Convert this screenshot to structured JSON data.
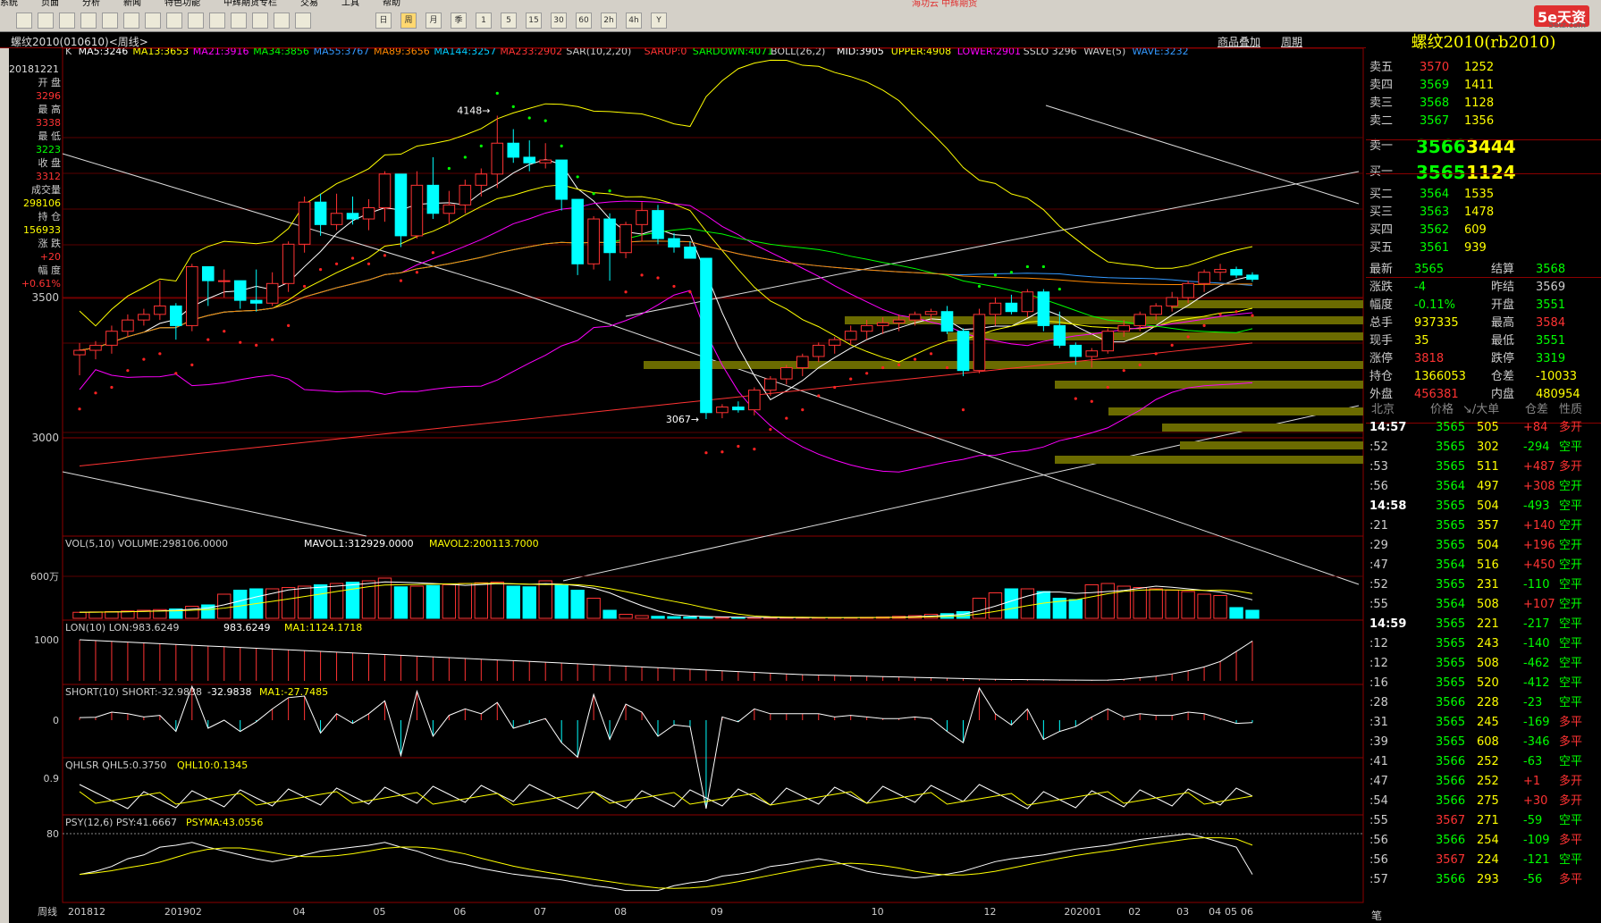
{
  "menu": [
    "系统",
    "页面",
    "分析",
    "新闻",
    "特色功能",
    "中辉期货专栏",
    "交易",
    "工具",
    "帮助"
  ],
  "broker": "海功云 中辉期货",
  "logo": {
    "text": "5e天资",
    "sub": "5etz.com"
  },
  "toolbar_period_labels": [
    "日",
    "周",
    "月",
    "季",
    "1",
    "5",
    "15",
    "30",
    "60",
    "2h",
    "4h",
    "Y"
  ],
  "window": {
    "title": "螺纹2010(010610)<周线>",
    "overlay": "商品叠加",
    "period": "周期"
  },
  "indicators": {
    "ma_line": "K  MA5:3246  MA13:3653  MA21:3916  MA34:3856  MA55:3767  MA89:3656  MA144:3257  MA233:2902  SAR(10,2,20)  SARUP:0  SARDOWN:4071  BOLL(26,2)  MID:3905  UPPER:4908  LOWER:2901  SSLO 3296  WAVE(5)  WAVE:3232"
  },
  "ind_parts": [
    {
      "t": "K",
      "c": "#cccccc"
    },
    {
      "t": "MA5:3246",
      "c": "#ffffff"
    },
    {
      "t": "MA13:3653",
      "c": "#ffff00"
    },
    {
      "t": "MA21:3916",
      "c": "#ff00ff"
    },
    {
      "t": "MA34:3856",
      "c": "#00ff00"
    },
    {
      "t": "MA55:3767",
      "c": "#3399ff"
    },
    {
      "t": "MA89:3656",
      "c": "#ff8800"
    },
    {
      "t": "MA144:3257",
      "c": "#00ccff"
    },
    {
      "t": "MA233:2902",
      "c": "#ff3333"
    },
    {
      "t": "SAR(10,2,20)",
      "c": "#cccccc"
    },
    {
      "t": "SARUP:0",
      "c": "#ff3333"
    },
    {
      "t": "SARDOWN:4071",
      "c": "#00ff00"
    },
    {
      "t": "BOLL(26,2)",
      "c": "#cccccc"
    },
    {
      "t": "MID:3905",
      "c": "#ffffff"
    },
    {
      "t": "UPPER:4908",
      "c": "#ffff00"
    },
    {
      "t": "LOWER:2901",
      "c": "#ff00ff"
    },
    {
      "t": "SSLO 3296",
      "c": "#cccccc"
    },
    {
      "t": "WAVE(5)",
      "c": "#cccccc"
    },
    {
      "t": "WAVE:3232",
      "c": "#3399ff"
    }
  ],
  "info": {
    "date": "20181221",
    "open_label": "开  盘",
    "open": "3296",
    "high_label": "最  高",
    "high": "3338",
    "low_label": "最  低",
    "low": "3223",
    "close_label": "收  盘",
    "close": "3312",
    "vol_label": "成交量",
    "vol": "298106",
    "oi_label": "持  仓",
    "oi": "156933",
    "chg_label": "涨  跌",
    "chg": "+20",
    "pct_label": "幅  度",
    "pct": "+0.61%"
  },
  "annotations": {
    "high": "4148",
    "low": "3067"
  },
  "panels": {
    "vol": {
      "label": "VOL(5,10)",
      "value": "VOLUME:298106.0000",
      "m1": "MAVOL1:312929.0000",
      "m2": "MAVOL2:200113.7000",
      "tick": "600万"
    },
    "lon": {
      "label": "LON(10)",
      "value": "LON:983.6249",
      "v2": "983.6249",
      "ma": "MA1:1124.1718",
      "tick": "1000"
    },
    "short": {
      "label": "SHORT(10)",
      "value": "SHORT:-32.9838",
      "v2": "-32.9838",
      "ma": "MA1:-27.7485",
      "tick": "0"
    },
    "qhl": {
      "label": "QHLSR",
      "value": "QHL5:0.3750",
      "ma": "QHL10:0.1345",
      "tick": "0.9"
    },
    "psy": {
      "label": "PSY(12,6)",
      "value": "PSY:41.6667",
      "ma": "PSYMA:43.0556",
      "tick": "80"
    }
  },
  "xaxis": {
    "period_label": "周线",
    "ticks": [
      "201812",
      "201902",
      "04",
      "05",
      "06",
      "07",
      "08",
      "09",
      "10",
      "12",
      "202001",
      "02",
      "03",
      "04",
      "05",
      "06"
    ]
  },
  "chart_data": {
    "type": "candlestick",
    "title": "螺纹2010(010610)<周线>",
    "yticks": [
      3500,
      3000
    ],
    "ohlc": [
      [
        3296,
        3338,
        3223,
        3312
      ],
      [
        3312,
        3345,
        3280,
        3330
      ],
      [
        3330,
        3400,
        3300,
        3380
      ],
      [
        3380,
        3440,
        3360,
        3420
      ],
      [
        3420,
        3460,
        3400,
        3440
      ],
      [
        3440,
        3560,
        3420,
        3470
      ],
      [
        3470,
        3480,
        3350,
        3400
      ],
      [
        3400,
        3620,
        3380,
        3610
      ],
      [
        3610,
        3560,
        3470,
        3560
      ],
      [
        3560,
        3600,
        3500,
        3560
      ],
      [
        3560,
        3560,
        3460,
        3490
      ],
      [
        3490,
        3600,
        3450,
        3480
      ],
      [
        3480,
        3590,
        3470,
        3550
      ],
      [
        3550,
        3700,
        3520,
        3690
      ],
      [
        3690,
        3860,
        3660,
        3840
      ],
      [
        3840,
        3870,
        3720,
        3760
      ],
      [
        3760,
        3870,
        3740,
        3800
      ],
      [
        3800,
        3860,
        3760,
        3780
      ],
      [
        3780,
        3850,
        3740,
        3820
      ],
      [
        3820,
        3950,
        3770,
        3940
      ],
      [
        3940,
        3940,
        3680,
        3720
      ],
      [
        3720,
        3950,
        3710,
        3900
      ],
      [
        3900,
        4000,
        3780,
        3800
      ],
      [
        3800,
        3880,
        3760,
        3830
      ],
      [
        3830,
        3920,
        3800,
        3900
      ],
      [
        3900,
        3960,
        3860,
        3940
      ],
      [
        3940,
        4148,
        3890,
        4050
      ],
      [
        4050,
        4100,
        3980,
        4000
      ],
      [
        4000,
        4060,
        3950,
        3980
      ],
      [
        3980,
        4050,
        3960,
        3990
      ],
      [
        3990,
        3960,
        3810,
        3850
      ],
      [
        3850,
        3850,
        3580,
        3620
      ],
      [
        3620,
        3790,
        3600,
        3780
      ],
      [
        3780,
        3800,
        3560,
        3660
      ],
      [
        3660,
        3770,
        3640,
        3760
      ],
      [
        3760,
        3840,
        3700,
        3810
      ],
      [
        3810,
        3830,
        3690,
        3710
      ],
      [
        3710,
        3730,
        3660,
        3680
      ],
      [
        3680,
        3700,
        3640,
        3640
      ],
      [
        3640,
        3640,
        3067,
        3090
      ],
      [
        3090,
        3120,
        3070,
        3110
      ],
      [
        3110,
        3130,
        3090,
        3100
      ],
      [
        3100,
        3180,
        3080,
        3170
      ],
      [
        3170,
        3220,
        3150,
        3210
      ],
      [
        3210,
        3260,
        3190,
        3250
      ],
      [
        3250,
        3300,
        3220,
        3290
      ],
      [
        3290,
        3340,
        3270,
        3330
      ],
      [
        3330,
        3360,
        3300,
        3350
      ],
      [
        3350,
        3400,
        3330,
        3380
      ],
      [
        3380,
        3420,
        3350,
        3400
      ],
      [
        3400,
        3430,
        3370,
        3410
      ],
      [
        3410,
        3440,
        3380,
        3420
      ],
      [
        3420,
        3450,
        3400,
        3440
      ],
      [
        3440,
        3460,
        3420,
        3450
      ],
      [
        3450,
        3470,
        3370,
        3380
      ],
      [
        3380,
        3390,
        3220,
        3240
      ],
      [
        3240,
        3460,
        3230,
        3440
      ],
      [
        3440,
        3500,
        3400,
        3480
      ],
      [
        3480,
        3510,
        3440,
        3450
      ],
      [
        3450,
        3530,
        3430,
        3520
      ],
      [
        3520,
        3530,
        3380,
        3400
      ],
      [
        3400,
        3450,
        3320,
        3330
      ],
      [
        3330,
        3340,
        3260,
        3290
      ],
      [
        3290,
        3320,
        3250,
        3310
      ],
      [
        3310,
        3390,
        3300,
        3380
      ],
      [
        3380,
        3420,
        3360,
        3400
      ],
      [
        3400,
        3450,
        3380,
        3440
      ],
      [
        3440,
        3480,
        3420,
        3470
      ],
      [
        3470,
        3520,
        3450,
        3500
      ],
      [
        3500,
        3560,
        3480,
        3550
      ],
      [
        3550,
        3600,
        3520,
        3590
      ],
      [
        3590,
        3620,
        3560,
        3600
      ],
      [
        3600,
        3610,
        3570,
        3580
      ],
      [
        3580,
        3590,
        3556,
        3565
      ]
    ],
    "volume": [
      90,
      95,
      100,
      110,
      120,
      130,
      140,
      180,
      200,
      360,
      420,
      440,
      440,
      460,
      480,
      500,
      520,
      540,
      560,
      600,
      470,
      480,
      490,
      500,
      520,
      530,
      540,
      480,
      470,
      560,
      500,
      420,
      300,
      120,
      60,
      40,
      30,
      25,
      20,
      18,
      15,
      12,
      10,
      10,
      10,
      10,
      10,
      10,
      12,
      15,
      20,
      30,
      40,
      60,
      70,
      100,
      300,
      380,
      440,
      440,
      400,
      300,
      280,
      500,
      520,
      480,
      460,
      440,
      420,
      400,
      360,
      340,
      160,
      120
    ],
    "lon": [
      1000,
      990,
      980,
      970,
      960,
      950,
      940,
      930,
      920,
      910,
      900,
      890,
      880,
      870,
      860,
      850,
      840,
      830,
      820,
      810,
      800,
      790,
      780,
      770,
      760,
      750,
      740,
      730,
      720,
      710,
      700,
      690,
      680,
      670,
      660,
      650,
      640,
      630,
      620,
      610,
      600,
      590,
      580,
      570,
      560,
      550,
      545,
      540,
      535,
      530,
      525,
      520,
      515,
      510,
      505,
      500,
      495,
      490,
      488,
      486,
      484,
      482,
      480,
      478,
      480,
      490,
      510,
      530,
      560,
      600,
      650,
      720,
      850,
      983
    ],
    "psy": [
      41.67,
      45,
      50,
      58,
      62,
      70,
      72,
      75,
      70,
      66,
      62,
      58,
      55,
      58,
      62,
      66,
      68,
      70,
      72,
      75,
      70,
      66,
      60,
      55,
      52,
      48,
      45,
      42,
      40,
      38,
      36,
      33,
      30,
      28,
      25,
      25,
      25,
      30,
      33,
      35,
      40,
      42,
      45,
      50,
      52,
      55,
      58,
      55,
      50,
      45,
      42,
      40,
      38,
      40,
      42,
      45,
      50,
      55,
      58,
      60,
      62,
      65,
      68,
      70,
      72,
      75,
      78,
      80,
      82,
      84,
      80,
      75,
      70,
      41.67
    ]
  },
  "quotes": {
    "asks": [
      {
        "label": "卖五",
        "price": "3570",
        "vol": "1252"
      },
      {
        "label": "卖四",
        "price": "3569",
        "vol": "1411"
      },
      {
        "label": "卖三",
        "price": "3568",
        "vol": "1128"
      },
      {
        "label": "卖二",
        "price": "3567",
        "vol": "1356"
      }
    ],
    "ask1": {
      "label": "卖一",
      "price": "3566",
      "vol": "3444"
    },
    "bid1": {
      "label": "买一",
      "price": "3565",
      "vol": "1124"
    },
    "bids": [
      {
        "label": "买二",
        "price": "3564",
        "vol": "1535"
      },
      {
        "label": "买三",
        "price": "3563",
        "vol": "1478"
      },
      {
        "label": "买四",
        "price": "3562",
        "vol": "609"
      },
      {
        "label": "买五",
        "price": "3561",
        "vol": "939"
      }
    ],
    "stats": [
      [
        "最新",
        "3565",
        "结算",
        "3568"
      ],
      [
        "涨跌",
        "-4",
        "昨结",
        "3569"
      ],
      [
        "幅度",
        "-0.11%",
        "开盘",
        "3551"
      ],
      [
        "总手",
        "937335",
        "最高",
        "3584"
      ],
      [
        "现手",
        "35",
        "最低",
        "3551"
      ],
      [
        "涨停",
        "3818",
        "跌停",
        "3319"
      ],
      [
        "持仓",
        "1366053",
        "仓差",
        "-10033"
      ],
      [
        "外盘",
        "456381",
        "内盘",
        "480954"
      ]
    ],
    "trade_header": [
      "北京",
      "价格",
      "↘/大单",
      "仓差",
      "性质"
    ],
    "trades": [
      [
        "14:57",
        "3565",
        "505",
        "+84",
        "多开"
      ],
      [
        ":52",
        "3565",
        "302",
        "-294",
        "空平"
      ],
      [
        ":53",
        "3565",
        "511",
        "+487",
        "多开"
      ],
      [
        ":56",
        "3564",
        "497",
        "+308",
        "空开"
      ],
      [
        "14:58",
        "3565",
        "504",
        "-493",
        "空平"
      ],
      [
        ":21",
        "3565",
        "357",
        "+140",
        "空开"
      ],
      [
        ":29",
        "3565",
        "504",
        "+196",
        "空开"
      ],
      [
        ":47",
        "3564",
        "516",
        "+450",
        "空开"
      ],
      [
        ":52",
        "3565",
        "231",
        "-110",
        "空平"
      ],
      [
        ":55",
        "3564",
        "508",
        "+107",
        "空开"
      ],
      [
        "14:59",
        "3565",
        "221",
        "-217",
        "空平"
      ],
      [
        ":12",
        "3565",
        "243",
        "-140",
        "空平"
      ],
      [
        ":12",
        "3565",
        "508",
        "-462",
        "空平"
      ],
      [
        ":16",
        "3565",
        "520",
        "-412",
        "空平"
      ],
      [
        ":28",
        "3566",
        "228",
        "-23",
        "空平"
      ],
      [
        ":31",
        "3565",
        "245",
        "-169",
        "多平"
      ],
      [
        ":39",
        "3565",
        "608",
        "-346",
        "多平"
      ],
      [
        ":41",
        "3566",
        "252",
        "-63",
        "空平"
      ],
      [
        ":47",
        "3566",
        "252",
        "+1",
        "多开"
      ],
      [
        ":54",
        "3566",
        "275",
        "+30",
        "多开"
      ],
      [
        ":55",
        "3567",
        "271",
        "-59",
        "空平"
      ],
      [
        ":56",
        "3566",
        "254",
        "-109",
        "多平"
      ],
      [
        ":56",
        "3567",
        "224",
        "-121",
        "空平"
      ],
      [
        ":57",
        "3566",
        "293",
        "-56",
        "多平"
      ]
    ],
    "tab": "笔"
  },
  "colors": {
    "up": "#ff3333",
    "down": "#00ffff",
    "grid": "#8b0000",
    "accent": "#ffff00"
  }
}
